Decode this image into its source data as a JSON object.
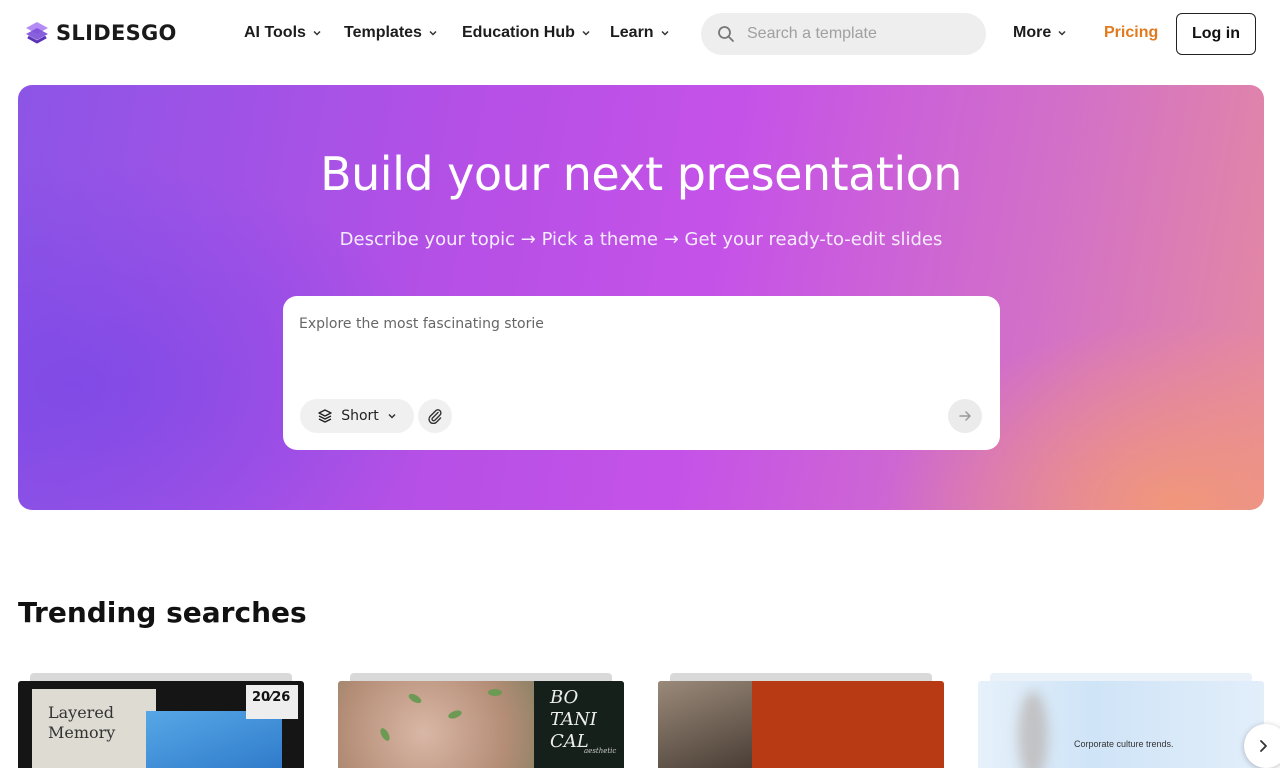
{
  "brand": {
    "name": "SLIDESGO",
    "color": "#8b5cf6"
  },
  "nav": {
    "items": [
      {
        "label": "AI Tools"
      },
      {
        "label": "Templates"
      },
      {
        "label": "Education Hub"
      },
      {
        "label": "Learn"
      }
    ],
    "search_placeholder": "Search a template",
    "more_label": "More",
    "pricing_label": "Pricing",
    "pricing_color": "#e07a1f",
    "login_label": "Log in"
  },
  "hero": {
    "title": "Build your next presentation",
    "subtitle": "Describe your topic → Pick a theme → Get your ready-to-edit slides",
    "prompt_value": "Explore the most fascinating storie",
    "length_label": "Short"
  },
  "trending": {
    "title": "Trending searches",
    "cards": [
      {
        "text": "Layered Memory",
        "tag": "20⁄26"
      },
      {
        "text": "BO TANI CAL",
        "note": "aesthetic"
      },
      {
        "text": ""
      },
      {
        "text": "Corporate culture trends."
      }
    ]
  },
  "icons": {
    "search": "search-icon",
    "layers": "layers-icon",
    "attach": "paperclip-icon",
    "send": "arrow-right-icon",
    "next": "chevron-right-icon"
  }
}
